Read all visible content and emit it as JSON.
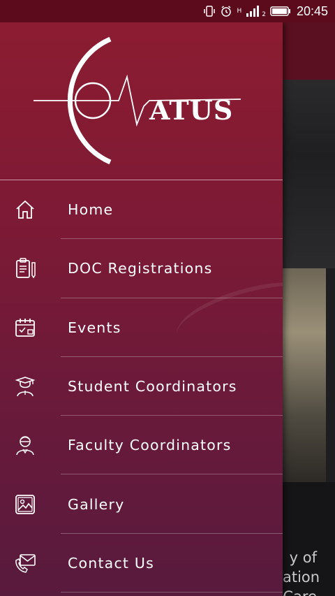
{
  "status_bar": {
    "time": "20:45",
    "network": "H",
    "sim_slot": "2"
  },
  "background_app": {
    "snippet_lines": [
      "y of",
      "ation",
      "Care"
    ]
  },
  "drawer": {
    "logo": {
      "text": "ATUS",
      "brand_color": "#ffffff"
    },
    "menu": [
      {
        "label": "Home",
        "icon": "home-icon"
      },
      {
        "label": "DOC Registrations",
        "icon": "clipboard-pen-icon"
      },
      {
        "label": "Events",
        "icon": "calendar-icon"
      },
      {
        "label": "Student Coordinators",
        "icon": "graduate-icon"
      },
      {
        "label": "Faculty Coordinators",
        "icon": "teacher-icon"
      },
      {
        "label": "Gallery",
        "icon": "image-icon"
      },
      {
        "label": "Contact Us",
        "icon": "envelope-phone-icon"
      }
    ]
  },
  "colors": {
    "drawer_top": "#8c1c31",
    "drawer_bottom": "#581a3d",
    "status_bar": "#5b0b1b"
  }
}
